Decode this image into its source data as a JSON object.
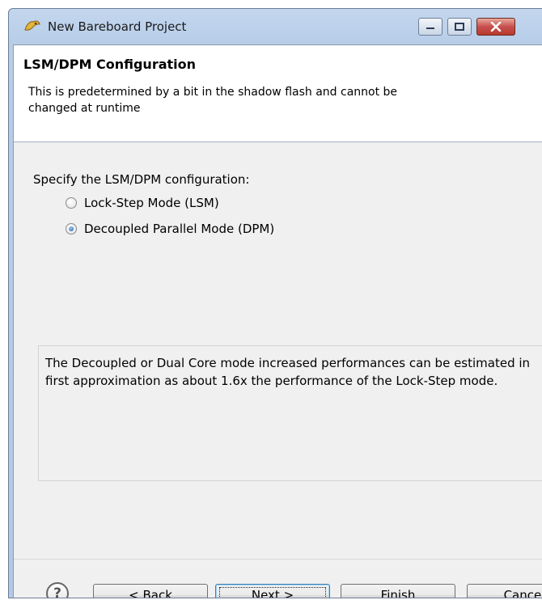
{
  "window": {
    "title": "New Bareboard Project",
    "title_icon": "bareboard-project-icon",
    "controls": [
      "minimize-icon",
      "maximize-icon",
      "close-icon"
    ]
  },
  "banner": {
    "title": "LSM/DPM Configuration",
    "description": "This is predetermined by a bit in the shadow flash and cannot be changed at runtime"
  },
  "config": {
    "group_label": "Specify the LSM/DPM configuration:",
    "options": [
      {
        "label": "Lock-Step Mode (LSM)",
        "checked": false
      },
      {
        "label": "Decoupled Parallel Mode (DPM)",
        "checked": true
      }
    ]
  },
  "description": {
    "text": "The Decoupled or Dual Core mode increased performances can be estimated in first approximation as about 1.6x the performance of the Lock-Step mode."
  },
  "footer": {
    "help_icon": "help-icon",
    "back": {
      "prefix": "< ",
      "mnemonic": "B",
      "rest": "ack"
    },
    "next": {
      "mnemonic": "N",
      "rest": "ext >"
    },
    "finish": {
      "mnemonic": "F",
      "rest": "inish"
    },
    "cancel_label": "Cancel"
  }
}
